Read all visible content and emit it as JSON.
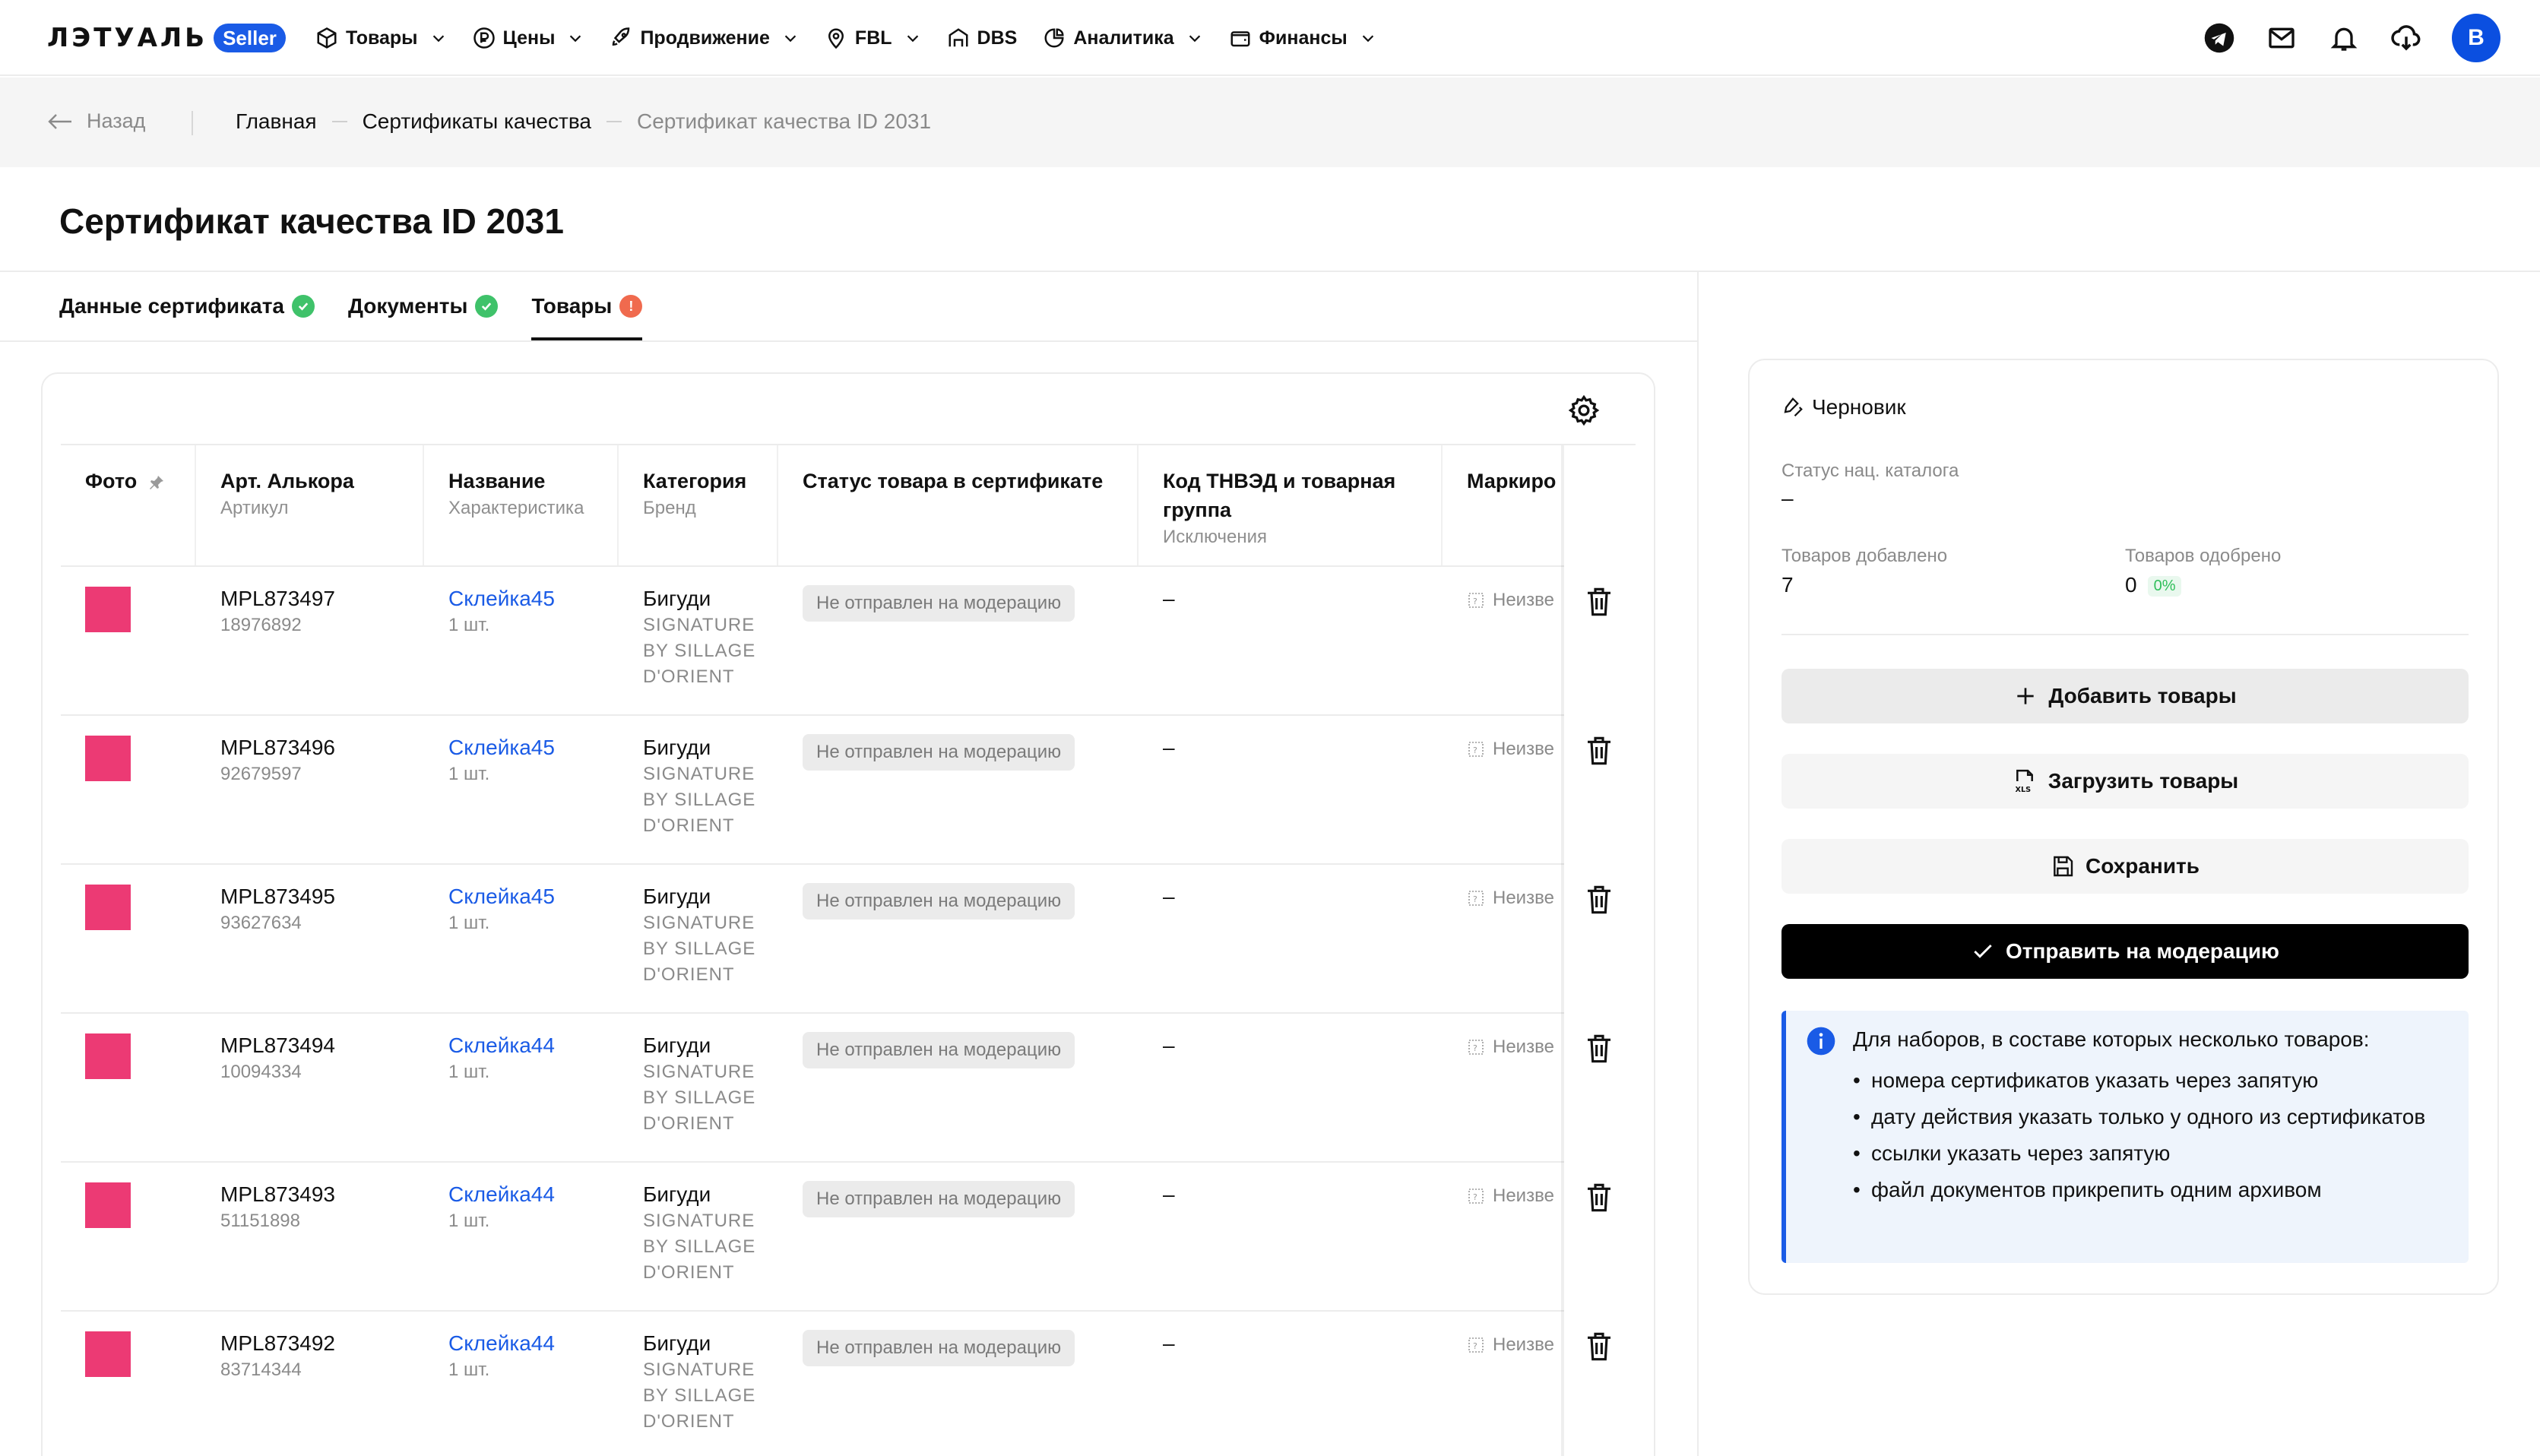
{
  "header": {
    "logo_text": "ЛЭТУАЛЬ",
    "logo_badge": "Seller",
    "nav": [
      {
        "label": "Товары",
        "icon": "box-icon"
      },
      {
        "label": "Цены",
        "icon": "ruble-icon"
      },
      {
        "label": "Продвижение",
        "icon": "rocket-icon"
      },
      {
        "label": "FBL",
        "icon": "location-pin-icon"
      },
      {
        "label": "DBS",
        "icon": "warehouse-icon"
      },
      {
        "label": "Аналитика",
        "icon": "pie-chart-icon"
      },
      {
        "label": "Финансы",
        "icon": "wallet-icon"
      }
    ],
    "avatar_letter": "В"
  },
  "breadcrumbs": {
    "back_label": "Назад",
    "items": [
      "Главная",
      "Сертификаты качества"
    ],
    "current": "Сертификат качества ID 2031"
  },
  "page": {
    "title": "Сертификат качества ID 2031"
  },
  "tabs": [
    {
      "label": "Данные сертификата",
      "status": "ok"
    },
    {
      "label": "Документы",
      "status": "ok"
    },
    {
      "label": "Товары",
      "status": "warning",
      "active": true
    }
  ],
  "table": {
    "columns": [
      {
        "title": "Фото",
        "sub": ""
      },
      {
        "title": "Арт. Алькора",
        "sub": "Артикул"
      },
      {
        "title": "Название",
        "sub": "Характеристика"
      },
      {
        "title": "Категория",
        "sub": "Бренд"
      },
      {
        "title": "Статус товара в сертификате",
        "sub": ""
      },
      {
        "title": "Код ТНВЭД и товарная",
        "title2": "группа",
        "sub": "Исключения"
      },
      {
        "title": "Маркиро",
        "sub": ""
      }
    ],
    "rows": [
      {
        "art": "MPL873497",
        "sku": "18976892",
        "name": "Склейка45",
        "qty": "1 шт.",
        "category": "Бигуди",
        "brand1": "SIGNATURE",
        "brand2": "BY SILLAGE",
        "brand3": "D'ORIENT",
        "status": "Не отправлен на модерацию",
        "code": "–",
        "marking": "Неизве"
      },
      {
        "art": "MPL873496",
        "sku": "92679597",
        "name": "Склейка45",
        "qty": "1 шт.",
        "category": "Бигуди",
        "brand1": "SIGNATURE",
        "brand2": "BY SILLAGE",
        "brand3": "D'ORIENT",
        "status": "Не отправлен на модерацию",
        "code": "–",
        "marking": "Неизве"
      },
      {
        "art": "MPL873495",
        "sku": "93627634",
        "name": "Склейка45",
        "qty": "1 шт.",
        "category": "Бигуди",
        "brand1": "SIGNATURE",
        "brand2": "BY SILLAGE",
        "brand3": "D'ORIENT",
        "status": "Не отправлен на модерацию",
        "code": "–",
        "marking": "Неизве"
      },
      {
        "art": "MPL873494",
        "sku": "10094334",
        "name": "Склейка44",
        "qty": "1 шт.",
        "category": "Бигуди",
        "brand1": "SIGNATURE",
        "brand2": "BY SILLAGE",
        "brand3": "D'ORIENT",
        "status": "Не отправлен на модерацию",
        "code": "–",
        "marking": "Неизве"
      },
      {
        "art": "MPL873493",
        "sku": "51151898",
        "name": "Склейка44",
        "qty": "1 шт.",
        "category": "Бигуди",
        "brand1": "SIGNATURE",
        "brand2": "BY SILLAGE",
        "brand3": "D'ORIENT",
        "status": "Не отправлен на модерацию",
        "code": "–",
        "marking": "Неизве"
      },
      {
        "art": "MPL873492",
        "sku": "83714344",
        "name": "Склейка44",
        "qty": "1 шт.",
        "category": "Бигуди",
        "brand1": "SIGNATURE",
        "brand2": "BY SILLAGE",
        "brand3": "D'ORIENT",
        "status": "Не отправлен на модерацию",
        "code": "–",
        "marking": "Неизве"
      }
    ]
  },
  "side": {
    "status_label": "Черновик",
    "catalog_status_label": "Статус нац. каталога",
    "catalog_status_value": "–",
    "added_label": "Товаров добавлено",
    "added_value": "7",
    "approved_label": "Товаров одобрено",
    "approved_value": "0",
    "approved_percent": "0%",
    "buttons": {
      "add": "Добавить товары",
      "upload": "Загрузить товары",
      "save": "Сохранить",
      "send": "Отправить на модерацию"
    },
    "info": {
      "title": "Для наборов, в составе которых несколько товаров:",
      "items": [
        "номера сертификатов указать через запятую",
        "дату действия указать только у одного из сертификатов",
        "ссылки указать через запятую",
        "файл документов прикрепить одним архивом"
      ]
    }
  },
  "colors": {
    "accent": "#1a5be6",
    "swatch": "#ec3a74",
    "ok": "#2fbf5a",
    "warning": "#f06a4e"
  }
}
